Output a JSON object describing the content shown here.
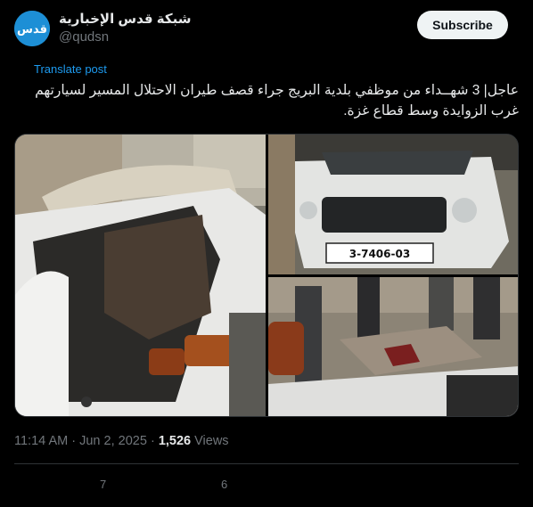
{
  "account": {
    "display_name": "شبكة قدس الإخبارية",
    "handle": "@qudsn",
    "avatar_text": "قدس",
    "avatar_color": "#1d8fd6"
  },
  "subscribe_label": "Subscribe",
  "translate_label": "Translate post",
  "post": {
    "line1": "عاجل| 3 شهــداء من موظفي بلدية البريج جراء قصف طيران الاحتلال المسير لسيارتهم",
    "line2": "غرب الزوايدة وسط قطاع غزة."
  },
  "media": {
    "plate_text": "3-7406-03",
    "images": [
      {
        "name": "destroyed-car-interior"
      },
      {
        "name": "damaged-car-front"
      },
      {
        "name": "casualty-scene"
      }
    ]
  },
  "meta": {
    "time": "11:14 AM",
    "separator": "·",
    "date": "Jun 2, 2025",
    "views_count": "1,526",
    "views_label": "Views"
  },
  "actions": {
    "reply_count": "7",
    "retweet_count": "6"
  },
  "colors": {
    "background": "#000000",
    "accent": "#1d9bf0",
    "secondary_text": "#71767b"
  }
}
